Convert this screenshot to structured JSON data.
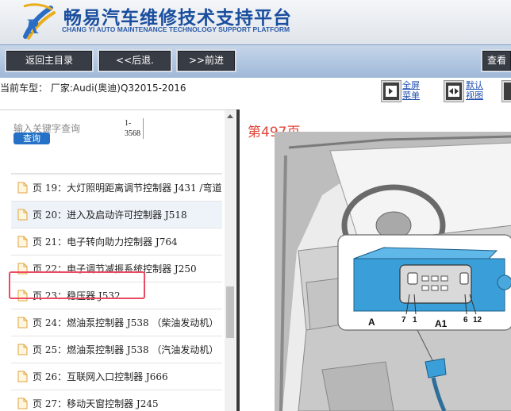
{
  "header": {
    "title_cn": "畅易汽车维修技术支持平台",
    "title_en": "CHANG YI AUTO MAINTENANCE TECHNOLOGY SUPPORT PLATFORM"
  },
  "toolbar": {
    "back_main": "返回主目录",
    "back": "<<后退.",
    "forward": ">>前进",
    "view_truncated": "查看"
  },
  "info": {
    "car": "当前车型： 厂家:Audi(奥迪)Q32015-2016",
    "fullscreen": [
      "全屏",
      "菜单"
    ],
    "default_view": [
      "默认",
      "视图"
    ]
  },
  "search": {
    "placeholder": "输入关键字查询",
    "button": "查询",
    "range_line1": "1-",
    "range_line2": "3568"
  },
  "toc": {
    "items": [
      {
        "label": ""
      },
      {
        "label": "页 19：大灯照明距离调节控制器 J431 /弯道"
      },
      {
        "label": "页 20：进入及启动许可控制器 J518"
      },
      {
        "label": "页 21：电子转向助力控制器 J764"
      },
      {
        "label": "页 22：电子调节减振系统控制器 J250"
      },
      {
        "label": "页 23：稳压器 J532"
      },
      {
        "label": "页 24：燃油泵控制器 J538 （柴油发动机）"
      },
      {
        "label": "页 25：燃油泵控制器 J538 （汽油发动机）"
      },
      {
        "label": "页 26：互联网入口控制器 J666"
      },
      {
        "label": "页 27：移动天窗控制器 J245"
      }
    ]
  },
  "viewer": {
    "page_label": "第497页",
    "callouts": {
      "a": "A",
      "a1": "A1",
      "n7": "7",
      "n1": "1",
      "n6": "6",
      "n12": "12"
    }
  },
  "colors": {
    "accent_blue": "#2471c6",
    "highlight_red": "#ea4b63",
    "page_label_red": "#e0453a",
    "connector_blue": "#3a9fd8"
  }
}
